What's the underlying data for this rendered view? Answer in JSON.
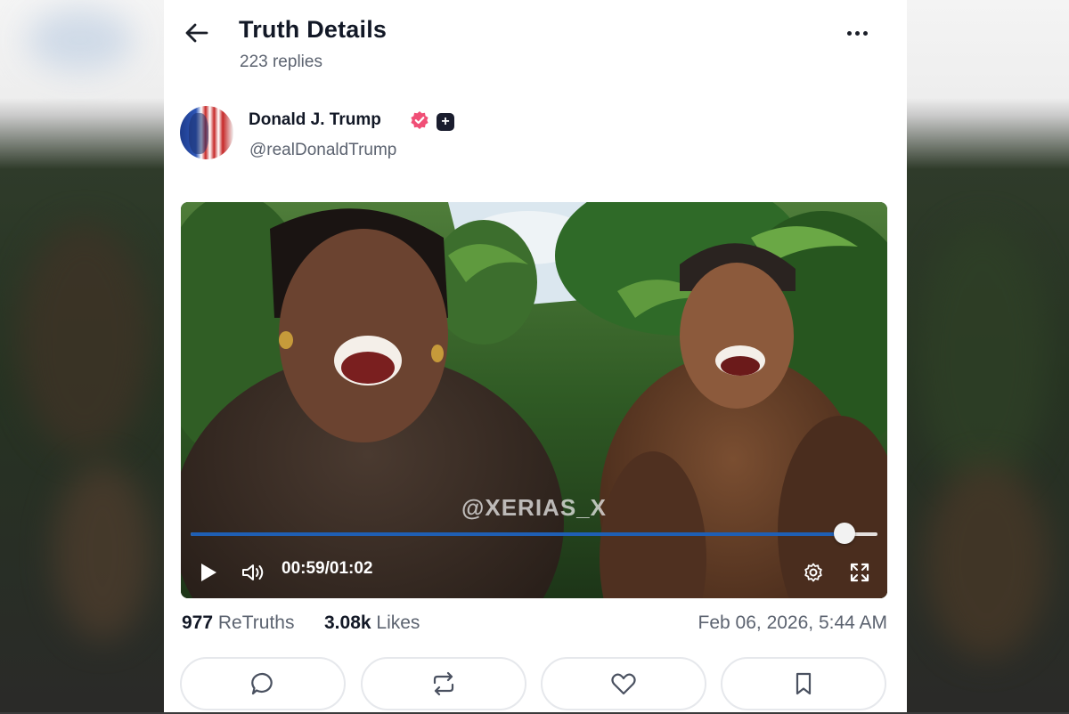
{
  "header": {
    "title": "Truth Details",
    "replies": "223 replies"
  },
  "post": {
    "author_name": "Donald J. Trump",
    "handle": "@realDonaldTrump",
    "video": {
      "watermark": "@XERIAS_X",
      "time": "00:59/01:02",
      "progress_fraction": 0.952
    },
    "stats": {
      "retruths_count": "977",
      "retruths_label": "ReTruths",
      "likes_count": "3.08k",
      "likes_label": "Likes",
      "timestamp": "Feb 06, 2026, 5:44 AM"
    }
  },
  "icons": {
    "back": "arrow-left-icon",
    "more": "more-horizontal-icon",
    "verified": "verified-badge-icon",
    "plus": "plus-badge-icon",
    "play": "play-icon",
    "volume": "volume-icon",
    "settings": "gear-icon",
    "fullscreen": "fullscreen-icon",
    "reply": "comment-icon",
    "retruth": "repost-icon",
    "like": "heart-icon",
    "bookmark": "bookmark-icon"
  },
  "colors": {
    "accent": "#1f5fb4",
    "verified": "#f04f76",
    "text_primary": "#121826",
    "text_secondary": "#5c6370"
  }
}
